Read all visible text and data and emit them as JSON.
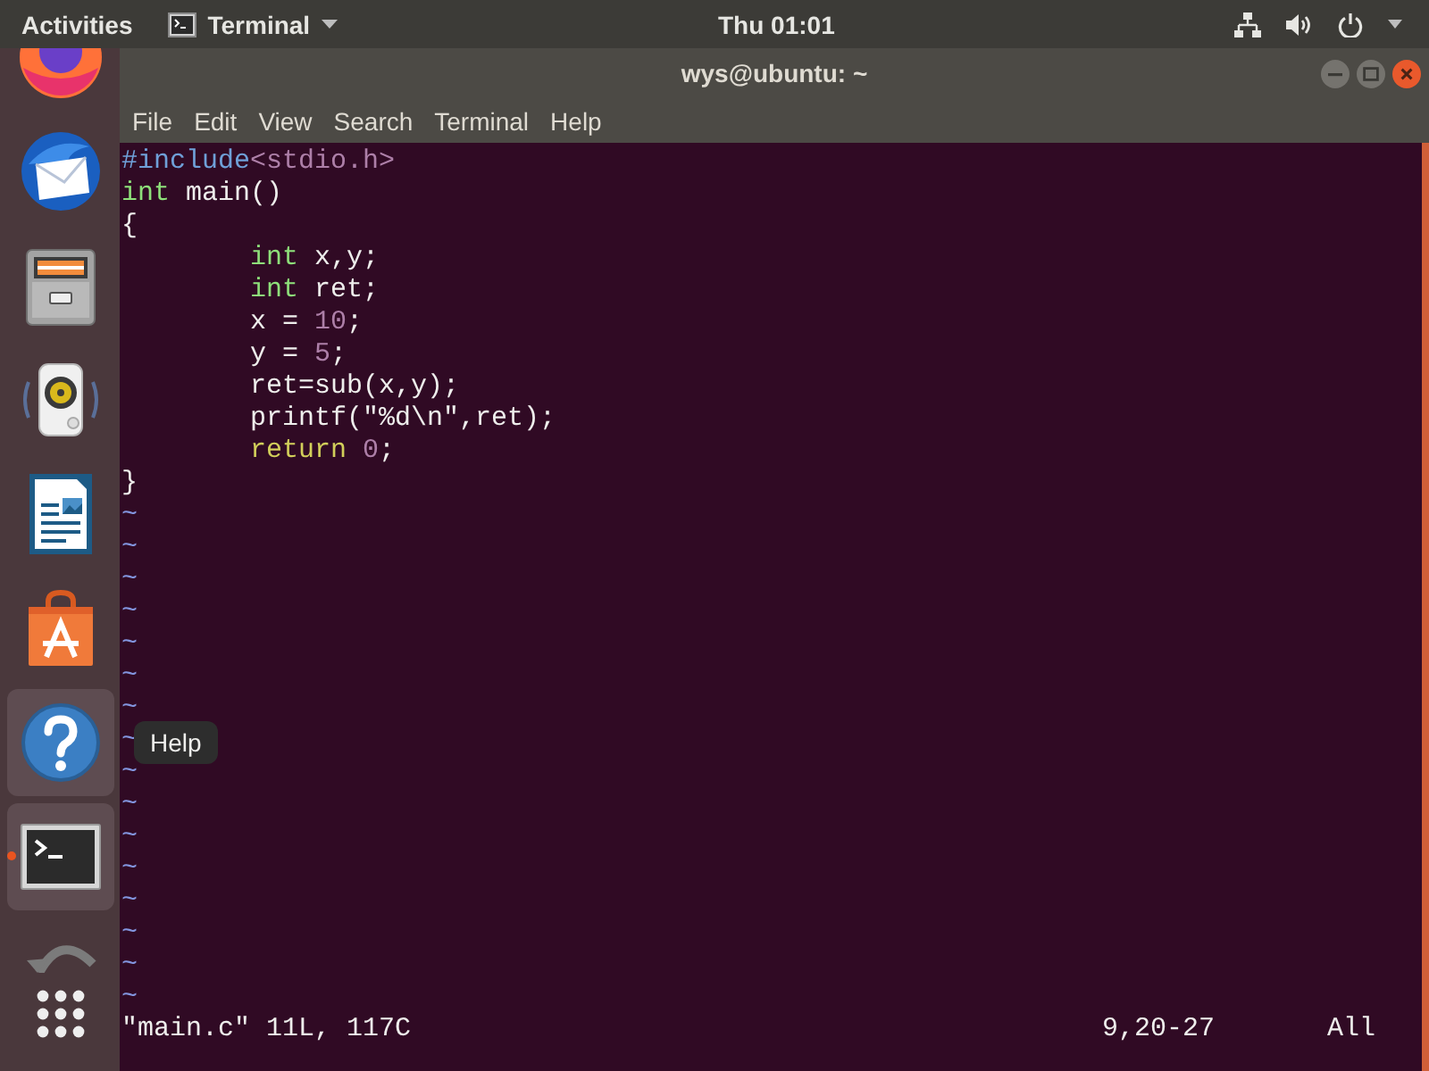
{
  "top_bar": {
    "activities": "Activities",
    "app_menu": "Terminal",
    "clock": "Thu 01:01"
  },
  "dock": {
    "items": [
      {
        "kind": "browser",
        "highlighted": false,
        "running": false
      },
      {
        "kind": "mail",
        "highlighted": false,
        "running": false
      },
      {
        "kind": "files",
        "highlighted": false,
        "running": false
      },
      {
        "kind": "music",
        "highlighted": false,
        "running": false
      },
      {
        "kind": "writer",
        "highlighted": false,
        "running": false
      },
      {
        "kind": "store",
        "highlighted": false,
        "running": false
      },
      {
        "kind": "help",
        "highlighted": true,
        "running": false
      },
      {
        "kind": "terminal",
        "highlighted": true,
        "running": true
      },
      {
        "kind": "updater",
        "highlighted": false,
        "running": false
      }
    ],
    "tooltip": "Help"
  },
  "window": {
    "title": "wys@ubuntu: ~",
    "menu": [
      "File",
      "Edit",
      "View",
      "Search",
      "Terminal",
      "Help"
    ]
  },
  "editor": {
    "lines": [
      {
        "tokens": [
          {
            "text": "#include",
            "kind": "preproc"
          },
          {
            "text": "<stdio.h>",
            "kind": "string"
          }
        ]
      },
      {
        "tokens": [
          {
            "text": "int",
            "kind": "type"
          },
          {
            "text": " main()",
            "kind": "normal"
          }
        ]
      },
      {
        "tokens": [
          {
            "text": "{",
            "kind": "normal"
          }
        ],
        "children": [
          {
            "tokens": [
              {
                "text": "int",
                "kind": "type"
              },
              {
                "text": " x,y;",
                "kind": "normal"
              }
            ]
          },
          {
            "tokens": [
              {
                "text": "int",
                "kind": "type"
              },
              {
                "text": " ret;",
                "kind": "normal"
              }
            ]
          },
          {
            "tokens": [
              {
                "text": "x = ",
                "kind": "normal"
              },
              {
                "text": "10",
                "kind": "number"
              },
              {
                "text": ";",
                "kind": "normal"
              }
            ]
          },
          {
            "tokens": [
              {
                "text": "y = ",
                "kind": "normal"
              },
              {
                "text": "5",
                "kind": "number"
              },
              {
                "text": ";",
                "kind": "normal"
              }
            ]
          },
          {
            "tokens": [
              {
                "text": "ret=sub(x,y);",
                "kind": "normal"
              }
            ]
          },
          {
            "tokens": [
              {
                "text": "printf(\"%d\\n\",ret);",
                "kind": "normal"
              }
            ]
          },
          {
            "tokens": [
              {
                "text": "return",
                "kind": "statement"
              },
              {
                "text": " 0",
                "kind": "number"
              },
              {
                "text": ";",
                "kind": "normal"
              }
            ]
          }
        ]
      },
      {
        "tokens": [
          {
            "text": "}",
            "kind": "normal"
          }
        ]
      }
    ],
    "filler_lines": [
      "~",
      "~",
      "~",
      "~",
      "~",
      "~",
      "~",
      "~",
      "~",
      "~",
      "~",
      "~",
      "~",
      "~",
      "~",
      "~"
    ],
    "status_line": {
      "message": "\"main.c\" 11L, 117C",
      "ruler": "9,20-27",
      "position": "All"
    }
  }
}
